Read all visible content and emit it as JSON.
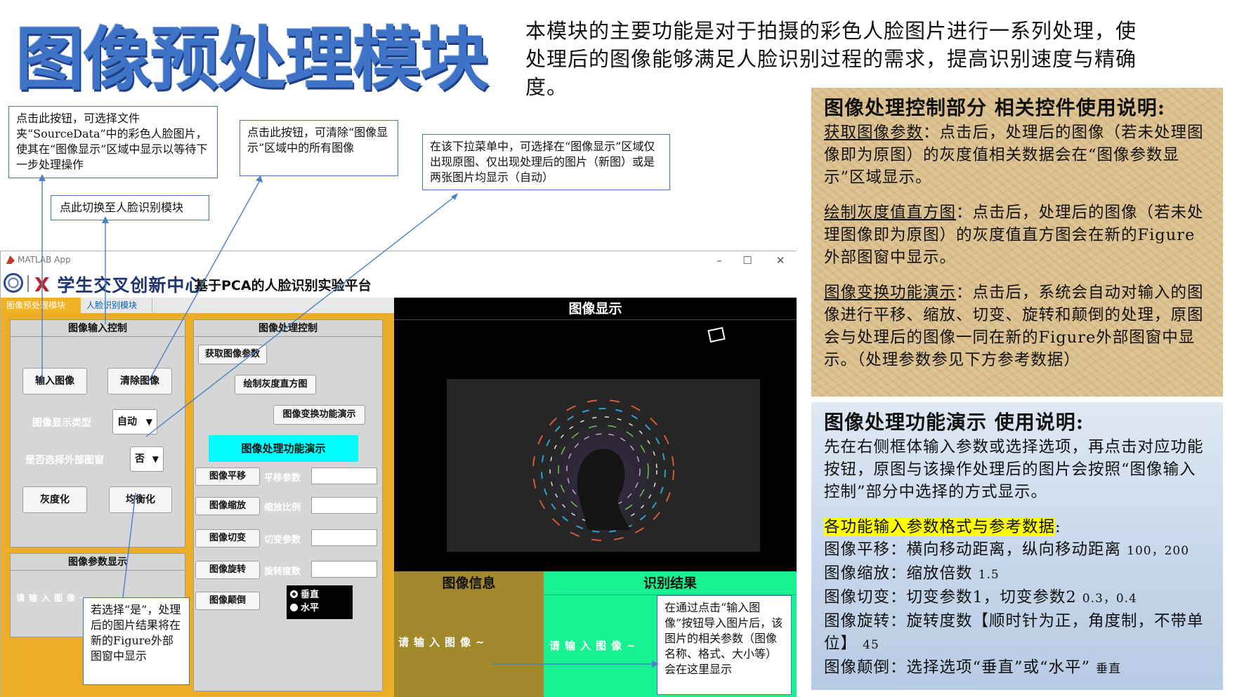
{
  "header": {
    "title": "图像预处理模块",
    "intro": "本模块的主要功能是对于拍摄的彩色人脸图片进行一系列处理，使处理后的图像能够满足人脸识别过程的需求，提高识别速度与精确度。"
  },
  "callouts": {
    "input_button": "点击此按钮，可选择文件夹“SourceData”中的彩色人脸图片，使其在“图像显示”区域中显示以等待下一步处理操作",
    "switch_module": "点此切换至人脸识别模块",
    "clear_button": "点击此按钮，可清除“图像显示”区域中的所有图像",
    "display_dropdown": "在该下拉菜单中，可选择在“图像显示”区域仅出现原图、仅出现处理后的图片（新图）或是两张图片均显示（自动）",
    "external_window": "若选择“是”，处理后的图片结果将在新的Figure外部图窗中显示",
    "info_area": "在通过点击“输入图像”按钮导入图片后，该图片的相关参数（图像名称、格式、大小等）会在这里显示"
  },
  "sidebar_control": {
    "heading": "图像处理控制部分 相关控件使用说明:",
    "items": [
      {
        "term": "获取图像参数",
        "desc": "：点击后，处理后的图像（若未处理图像即为原图）的灰度值相关数据会在“图像参数显示”区域显示。"
      },
      {
        "term": "绘制灰度值直方图",
        "desc": "：点击后，处理后的图像（若未处理图像即为原图）的灰度值直方图会在新的Figure外部图窗中显示。"
      },
      {
        "term": "图像变换功能演示",
        "desc": "：点击后，系统会自动对输入的图像进行平移、缩放、切变、旋转和颠倒的处理，原图会与处理后的图像一同在新的Figure外部图窗中显示。（处理参数参见下方参考数据）"
      }
    ]
  },
  "sidebar_demo": {
    "heading": "图像处理功能演示 使用说明:",
    "intro": "先在右侧框体输入参数或选择选项，再点击对应功能按钮，原图与该操作处理后的图片会按照“图像输入控制”部分中选择的方式显示。",
    "format_heading": "各功能输入参数格式与参考数据",
    "format_colon": ":",
    "rows": [
      {
        "text": "图像平移：横向移动距离，纵向移动距离",
        "ref": "100，200"
      },
      {
        "text": "图像缩放：缩放倍数",
        "ref": "1.5"
      },
      {
        "text": "图像切变：切变参数1，切变参数2",
        "ref": "0.3，0.4"
      },
      {
        "text": "图像旋转：旋转度数【顺时针为正，角度制，不带单位】",
        "ref": "45"
      },
      {
        "text": "图像颠倒：选择选项“垂直”或“水平”",
        "ref": "垂直"
      }
    ]
  },
  "app": {
    "window_title": "MATLAB App",
    "logo_text": "学生交叉创新中心",
    "platform_title": "基于PCA的人脸识别实验平台",
    "tabs": [
      "图像预处理模块",
      "人脸识别模块"
    ],
    "input_panel": {
      "title": "图像输入控制",
      "input_button": "输入图像",
      "clear_button": "清除图像",
      "display_type_label": "图像显示类型",
      "display_type_value": "自动",
      "external_label": "是否选择外部图窗",
      "external_value": "否",
      "gray_button": "灰度化",
      "equalize_button": "均衡化"
    },
    "param_panel": {
      "title": "图像参数显示",
      "placeholder": "请输入图像~"
    },
    "process_panel": {
      "title": "图像处理控制",
      "get_params_button": "获取图像参数",
      "histogram_button": "绘制灰度直方图",
      "transform_demo_button": "图像变换功能演示",
      "demo_label": "图像处理功能演示",
      "ops": [
        {
          "button": "图像平移",
          "label": "平移参数"
        },
        {
          "button": "图像缩放",
          "label": "缩放比例"
        },
        {
          "button": "图像切变",
          "label": "切变参数"
        },
        {
          "button": "图像旋转",
          "label": "旋转度数"
        }
      ],
      "flip_button": "图像颠倒",
      "flip_options": [
        "垂直",
        "水平"
      ],
      "flip_selected": "垂直"
    },
    "image_display": {
      "title": "图像显示"
    },
    "image_info": {
      "title": "图像信息",
      "placeholder": "请输入图像~"
    },
    "recognition": {
      "title": "识别结果",
      "placeholder": "请输入图像~"
    }
  },
  "colors": {
    "title_blue": "#3f73c7",
    "panel_orange": "#edae26",
    "cyan": "#00ffff",
    "result_green": "#16f28f",
    "info_olive": "#a28a2c"
  }
}
